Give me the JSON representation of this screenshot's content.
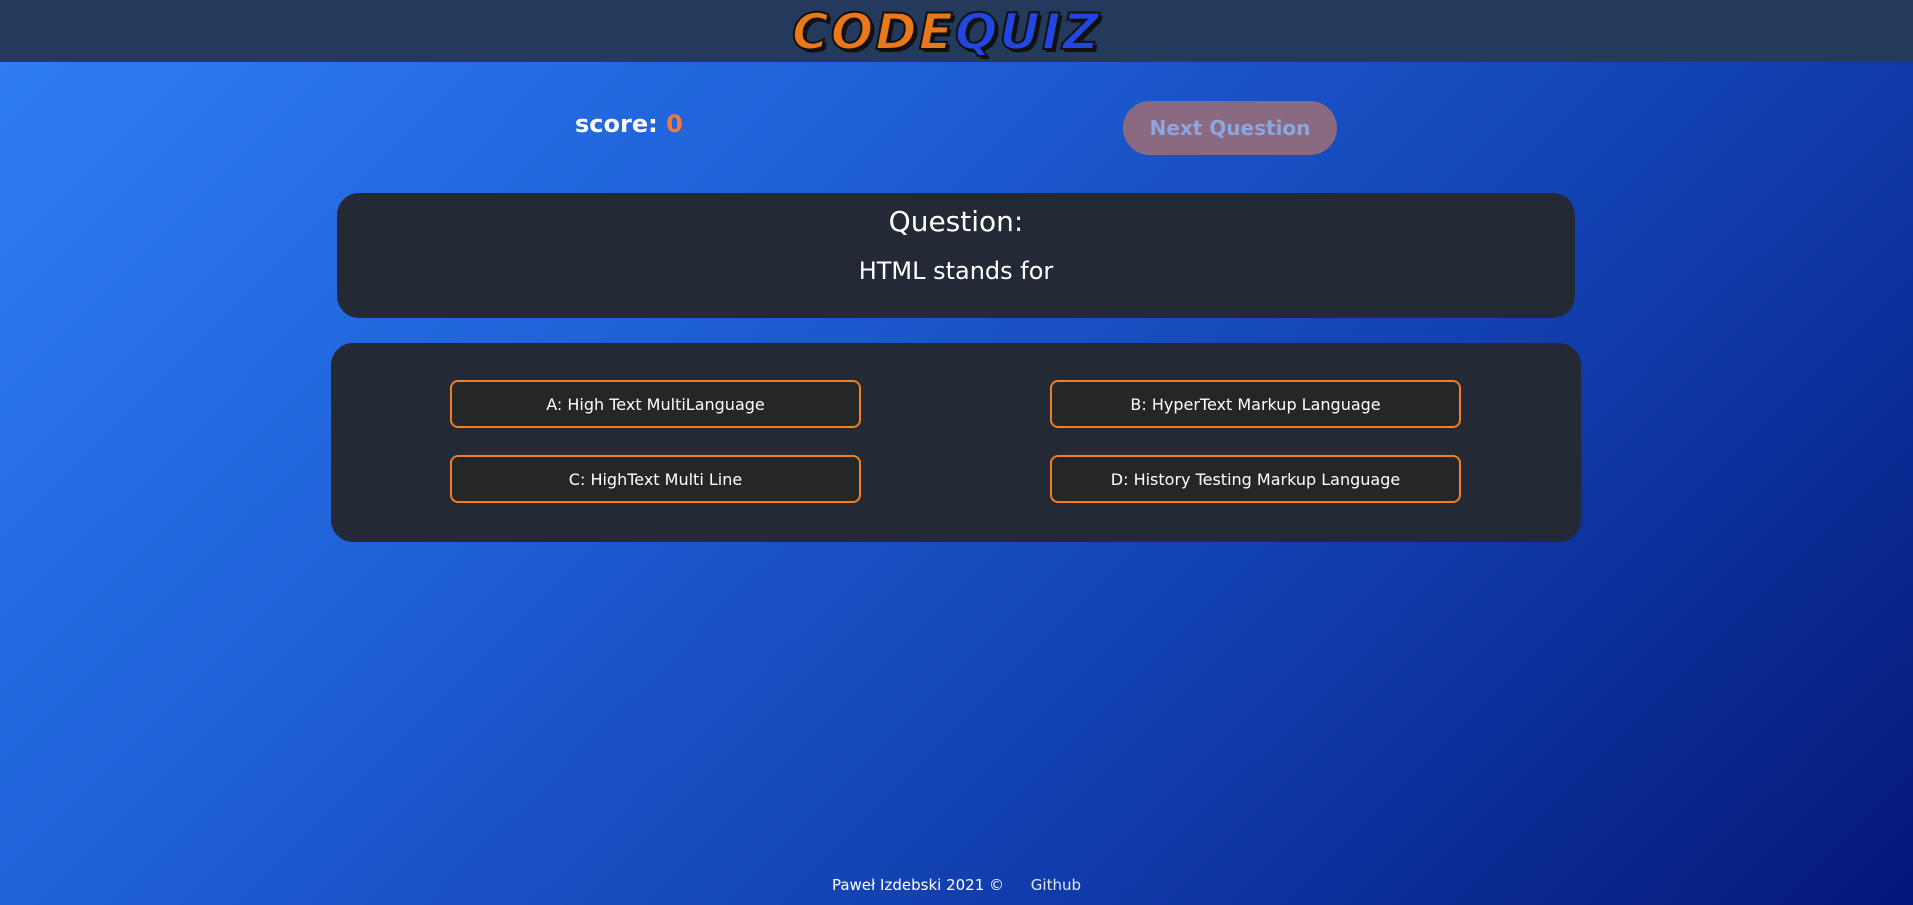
{
  "header": {
    "logo_part1": "CODE",
    "logo_part2": "QUIZ"
  },
  "score": {
    "label": "score:",
    "value": "0"
  },
  "controls": {
    "next_label": "Next Question"
  },
  "question": {
    "heading": "Question:",
    "text": "HTML stands for"
  },
  "answers": [
    {
      "label": "A: High Text MultiLanguage"
    },
    {
      "label": "B: HyperText Markup Language"
    },
    {
      "label": "C: HighText Multi Line"
    },
    {
      "label": "D: History Testing Markup Language"
    }
  ],
  "footer": {
    "copyright": "Paweł Izdebski 2021 ©",
    "github_label": "Github"
  },
  "colors": {
    "accent_orange": "#f07e26",
    "score_value": "#f07a3a",
    "panel": "#232a36",
    "topbar": "#233a5c"
  }
}
